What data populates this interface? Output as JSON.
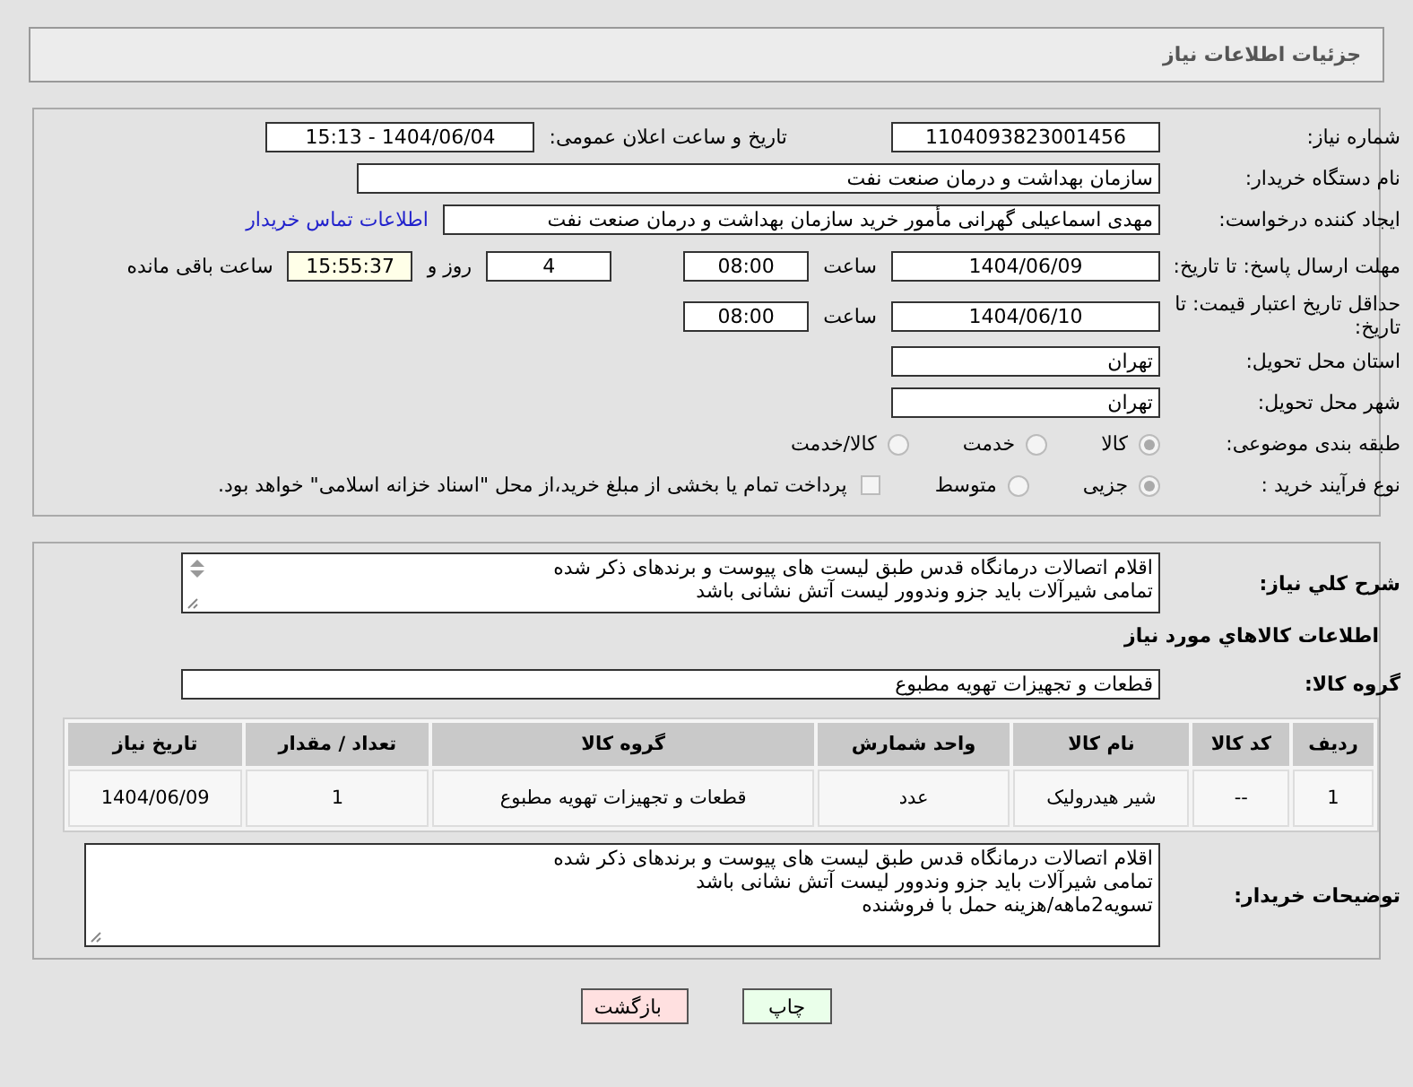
{
  "header": {
    "title": "جزئیات اطلاعات نیاز"
  },
  "need_number": {
    "label": "شماره نیاز:",
    "value": "1104093823001456"
  },
  "announce": {
    "label": "تاریخ و ساعت اعلان عمومی:",
    "value": "1404/06/04 - 15:13"
  },
  "buyer_org": {
    "label": "نام دستگاه خریدار:",
    "value": "سازمان بهداشت و درمان صنعت نفت"
  },
  "creator": {
    "label": "ایجاد کننده درخواست:",
    "value": "مهدی اسماعیلی گهرانی مأمور خرید سازمان بهداشت و درمان صنعت نفت",
    "link": "اطلاعات تماس خریدار"
  },
  "deadline": {
    "label": "مهلت ارسال پاسخ: تا تاریخ:",
    "date": "1404/06/09",
    "time_label": "ساعت",
    "time": "08:00",
    "days": "4",
    "days_label": "روز و",
    "remaining": "15:55:37",
    "remaining_label": "ساعت باقی مانده"
  },
  "validity": {
    "label": "حداقل تاریخ اعتبار قیمت: تا تاریخ:",
    "date": "1404/06/10",
    "time_label": "ساعت",
    "time": "08:00"
  },
  "province": {
    "label": "استان محل تحویل:",
    "value": "تهران"
  },
  "city": {
    "label": "شهر محل تحویل:",
    "value": "تهران"
  },
  "category": {
    "label": "طبقه بندی موضوعی:",
    "options": [
      {
        "label": "کالا",
        "selected": true
      },
      {
        "label": "خدمت",
        "selected": false
      },
      {
        "label": "کالا/خدمت",
        "selected": false
      }
    ]
  },
  "process": {
    "label": "نوع فرآیند خرید :",
    "options": [
      {
        "label": "جزیی",
        "selected": true
      },
      {
        "label": "متوسط",
        "selected": false
      }
    ],
    "treasury": {
      "label": "پرداخت تمام یا بخشی از مبلغ خرید،از محل \"اسناد خزانه اسلامی\" خواهد بود.",
      "checked": false
    }
  },
  "description": {
    "label": "شرح کلي نياز:",
    "lines": [
      "اقلام اتصالات درمانگاه قدس طبق لیست های پیوست و برندهای ذکر شده",
      "تمامی شیرآلات باید جزو وندوور لیست آتش نشانی باشد"
    ]
  },
  "goods_title": "اطلاعات کالاهاي مورد نياز",
  "goods_group": {
    "label": "گروه کالا:",
    "value": "قطعات و تجهیزات تهویه مطبوع"
  },
  "table": {
    "columns": [
      "ردیف",
      "کد کالا",
      "نام کالا",
      "واحد شمارش",
      "گروه کالا",
      "تعداد / مقدار",
      "تاریخ نیاز"
    ],
    "rows": [
      [
        "1",
        "--",
        "شیر هیدرولیک",
        "عدد",
        "قطعات و تجهیزات تهویه مطبوع",
        "1",
        "1404/06/09"
      ]
    ]
  },
  "buyer_notes": {
    "label": "توضیحات خریدار:",
    "lines": [
      "اقلام اتصالات درمانگاه قدس طبق لیست های پیوست و برندهای ذکر شده",
      "تمامی شیرآلات باید جزو وندوور لیست آتش نشانی باشد",
      "تسویه2ماهه/هزینه حمل با فروشنده"
    ]
  },
  "buttons": [
    {
      "label": "چاپ",
      "kind": "print"
    },
    {
      "label": "بازگشت",
      "kind": "back"
    }
  ]
}
